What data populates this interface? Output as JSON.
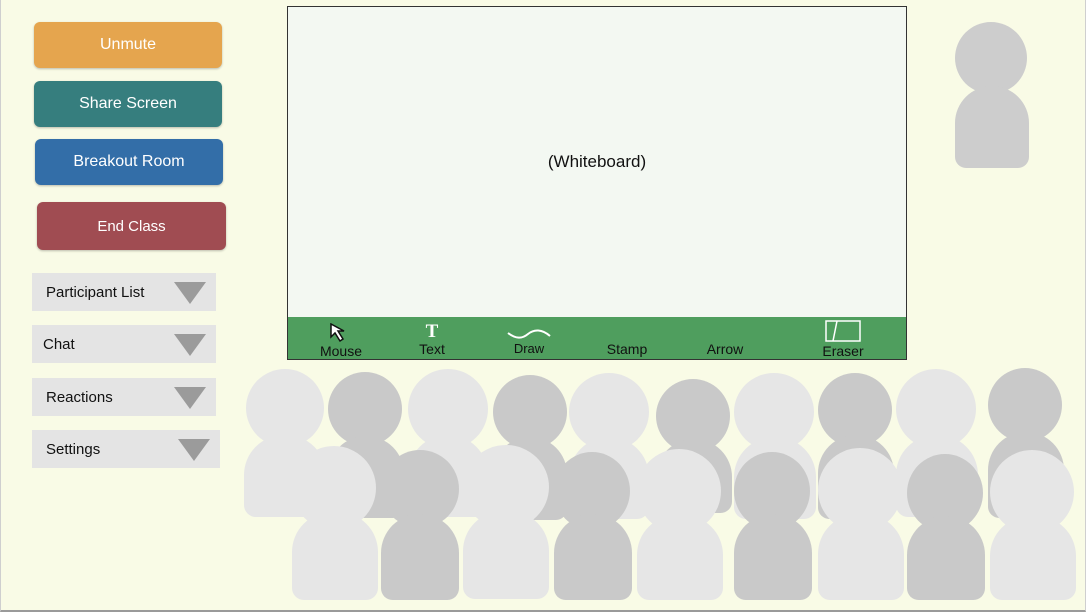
{
  "controls": {
    "unmute_label": "Unmute",
    "share_screen_label": "Share Screen",
    "breakout_room_label": "Breakout Room",
    "end_class_label": "End Class"
  },
  "panels": [
    {
      "label": "Participant List"
    },
    {
      "label": "Chat"
    },
    {
      "label": "Reactions"
    },
    {
      "label": "Settings"
    }
  ],
  "whiteboard": {
    "label": "(Whiteboard)",
    "tools": [
      {
        "label": "Mouse",
        "icon": "arrow-cursor-icon"
      },
      {
        "label": "Text",
        "icon": "text-t-icon"
      },
      {
        "label": "Draw",
        "icon": "squiggle-icon"
      },
      {
        "label": "Stamp",
        "icon": ""
      },
      {
        "label": "Arrow",
        "icon": ""
      },
      {
        "label": "Eraser",
        "icon": "eraser-icon"
      }
    ]
  },
  "colors": {
    "background": "#f9fbe6",
    "unmute": "#e5a54e",
    "share_screen": "#367e7e",
    "breakout_room": "#336ea8",
    "end_class": "#a04c52",
    "toolbar": "#4f9e5e"
  }
}
